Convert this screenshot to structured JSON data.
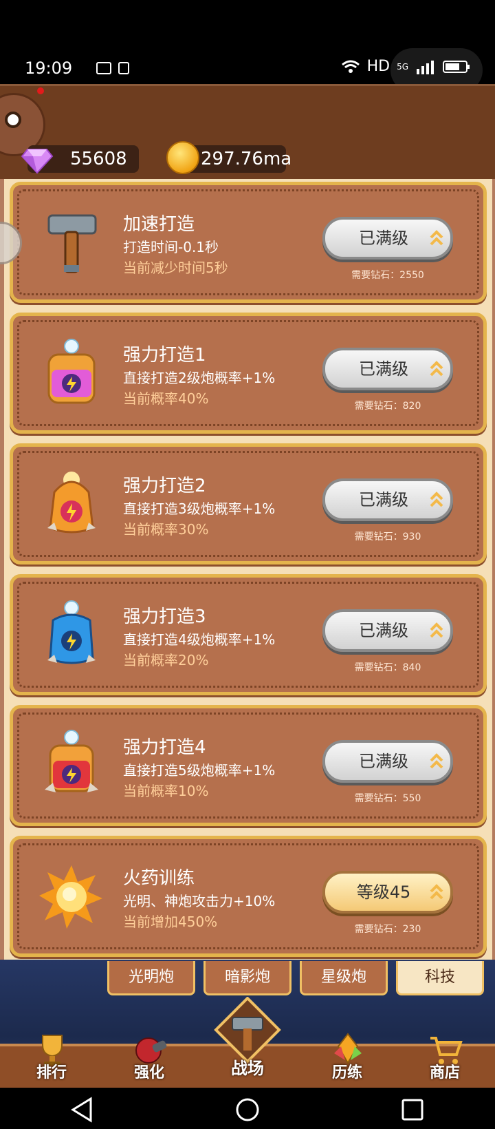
{
  "status_bar": {
    "time": "19:09",
    "network": "HD",
    "signal": "5G"
  },
  "header": {
    "diamonds": "55608",
    "gold": "297.76ma"
  },
  "upgrades": [
    {
      "icon": "hammer-icon",
      "title": "加速打造",
      "desc": "打造时间-0.1秒",
      "current": "当前减少时间5秒",
      "button": "已满级",
      "cost": "需要钻石：2550",
      "maxed": true
    },
    {
      "icon": "yellow-capsule-icon",
      "title": "强力打造1",
      "desc": "直接打造2级炮概率+1%",
      "current": "当前概率40%",
      "button": "已满级",
      "cost": "需要钻石：820",
      "maxed": true
    },
    {
      "icon": "orange-capsule-icon",
      "title": "强力打造2",
      "desc": "直接打造3级炮概率+1%",
      "current": "当前概率30%",
      "button": "已满级",
      "cost": "需要钻石：930",
      "maxed": true
    },
    {
      "icon": "blue-capsule-icon",
      "title": "强力打造3",
      "desc": "直接打造4级炮概率+1%",
      "current": "当前概率20%",
      "button": "已满级",
      "cost": "需要钻石：840",
      "maxed": true
    },
    {
      "icon": "red-capsule-icon",
      "title": "强力打造4",
      "desc": "直接打造5级炮概率+1%",
      "current": "当前概率10%",
      "button": "已满级",
      "cost": "需要钻石：550",
      "maxed": true
    },
    {
      "icon": "explosion-icon",
      "title": "火药训练",
      "desc": "光明、神炮攻击力+10%",
      "current": "当前增加450%",
      "button": "等级45",
      "cost": "需要钻石：230",
      "maxed": false
    }
  ],
  "sub_tabs": [
    "光明炮",
    "暗影炮",
    "星级炮",
    "科技"
  ],
  "sub_tab_active": "科技",
  "nav": [
    {
      "icon": "trophy-icon",
      "label": "排行"
    },
    {
      "icon": "cannon-icon",
      "label": "强化"
    },
    {
      "icon": "hammer-icon",
      "label": "战场"
    },
    {
      "icon": "gems-icon",
      "label": "历练"
    },
    {
      "icon": "cart-icon",
      "label": "商店"
    }
  ],
  "colors": {
    "accent_gold": "#e4b44c",
    "card": "#b5704d",
    "header": "#6e3d1f"
  }
}
